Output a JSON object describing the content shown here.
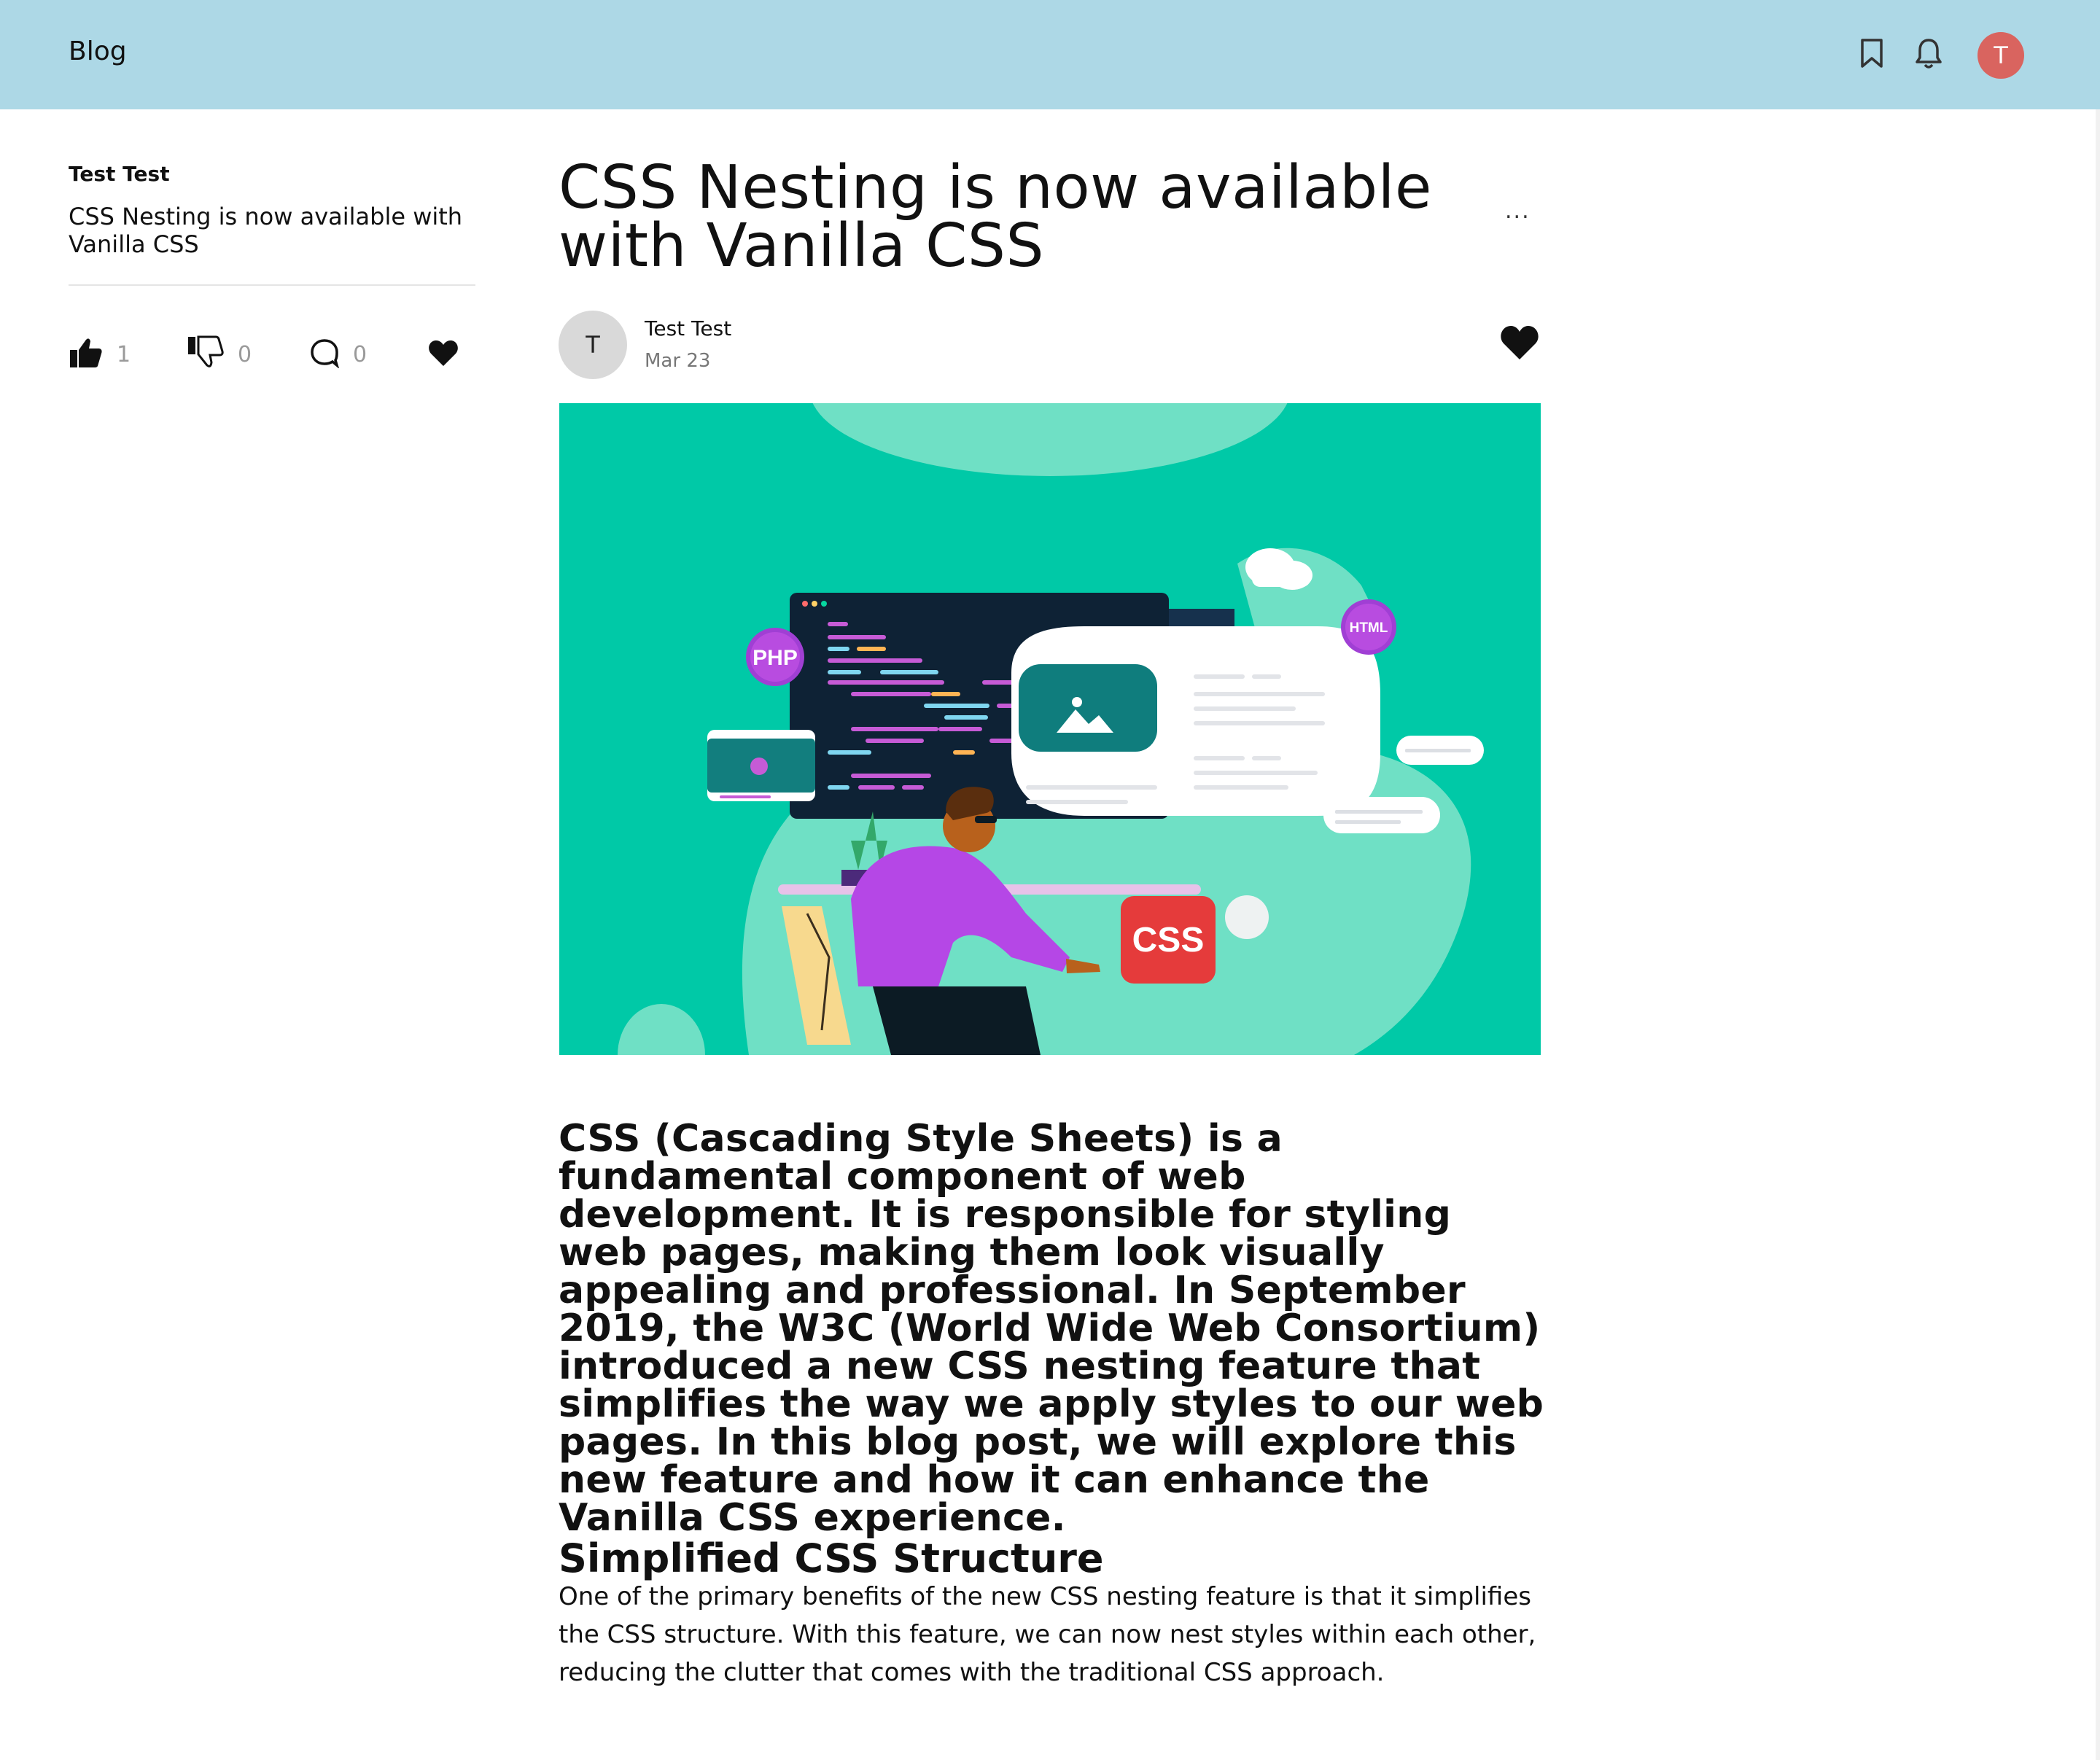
{
  "header": {
    "brand": "Blog",
    "bookmark_icon": "bookmark-icon",
    "bell_icon": "bell-icon",
    "avatar_initial": "T"
  },
  "sidebar": {
    "author": "Test Test",
    "post_title": "CSS Nesting is now available with Vanilla CSS",
    "likes": "1",
    "dislikes": "0",
    "comments": "0"
  },
  "article": {
    "title": "CSS Nesting is now available with Vanilla CSS",
    "more_label": "...",
    "author_initial": "T",
    "author_name": "Test Test",
    "date": "Mar 23",
    "hero": {
      "labels": {
        "php": "PHP",
        "html": "HTML",
        "css": "CSS"
      }
    },
    "lead": "CSS (Cascading Style Sheets) is a fundamental component of web development. It is responsible for styling web pages, making them look visually appealing and professional. In September 2019, the W3C (World Wide Web Consortium) introduced a new CSS nesting feature that simplifies the way we apply styles to our web pages. In this blog post, we will explore this new feature and how it can enhance the Vanilla CSS experience.",
    "section_heading": "Simplified CSS Structure",
    "section_body": "One of the primary benefits of the new CSS nesting feature is that it simplifies the CSS structure. With this feature, we can now nest styles within each other, reducing the clutter that comes with the traditional CSS approach."
  },
  "colors": {
    "header_bg": "#add8e6",
    "avatar_bg": "#d9645f",
    "hero_bg": "#00c9a7"
  }
}
